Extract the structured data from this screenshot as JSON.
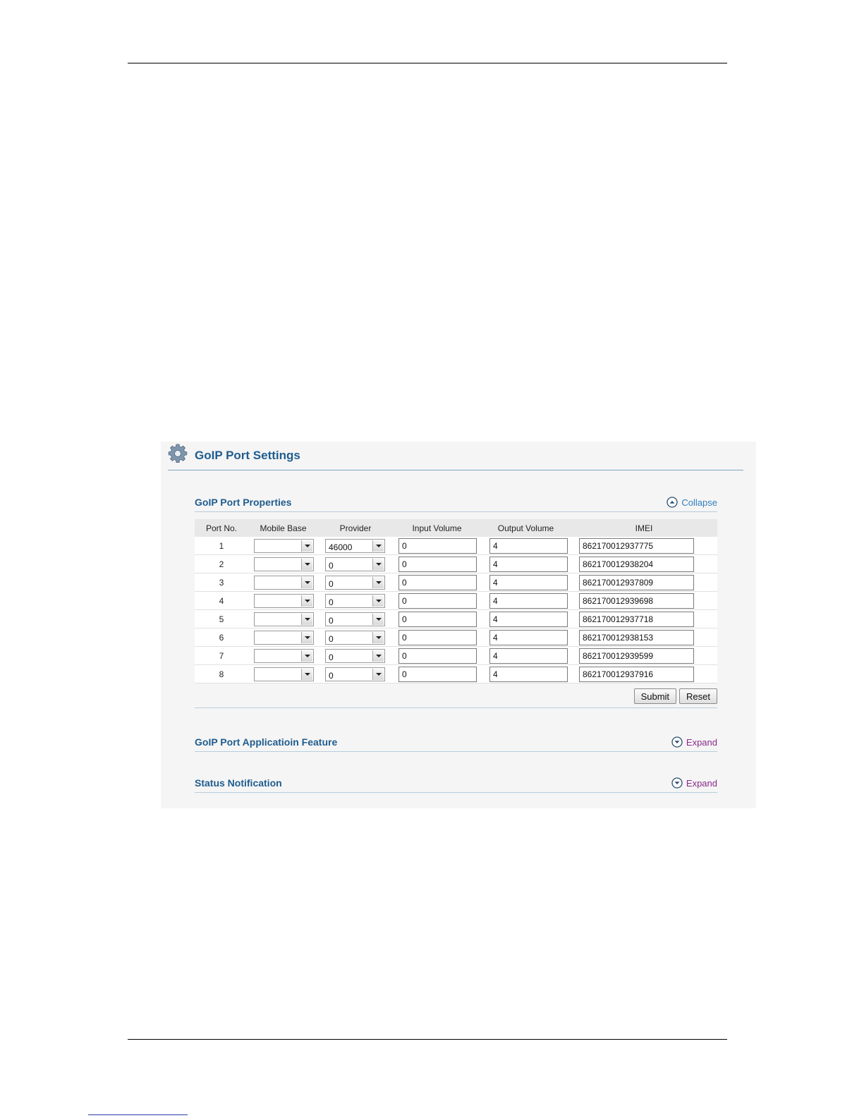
{
  "page": {
    "title": "GoIP Port Settings",
    "accent_color": "#1f5c8e"
  },
  "properties": {
    "title": "GoIP Port Properties",
    "toggle_label": "Collapse",
    "columns": [
      "Port No.",
      "Mobile Base",
      "Provider",
      "Input Volume",
      "Output Volume",
      "IMEI"
    ],
    "rows": [
      {
        "port": "1",
        "mobile_base": "",
        "provider": "46000",
        "input_volume": "0",
        "output_volume": "4",
        "imei": "862170012937775"
      },
      {
        "port": "2",
        "mobile_base": "",
        "provider": "0",
        "input_volume": "0",
        "output_volume": "4",
        "imei": "862170012938204"
      },
      {
        "port": "3",
        "mobile_base": "",
        "provider": "0",
        "input_volume": "0",
        "output_volume": "4",
        "imei": "862170012937809"
      },
      {
        "port": "4",
        "mobile_base": "",
        "provider": "0",
        "input_volume": "0",
        "output_volume": "4",
        "imei": "862170012939698"
      },
      {
        "port": "5",
        "mobile_base": "",
        "provider": "0",
        "input_volume": "0",
        "output_volume": "4",
        "imei": "862170012937718"
      },
      {
        "port": "6",
        "mobile_base": "",
        "provider": "0",
        "input_volume": "0",
        "output_volume": "4",
        "imei": "862170012938153"
      },
      {
        "port": "7",
        "mobile_base": "",
        "provider": "0",
        "input_volume": "0",
        "output_volume": "4",
        "imei": "862170012939599"
      },
      {
        "port": "8",
        "mobile_base": "",
        "provider": "0",
        "input_volume": "0",
        "output_volume": "4",
        "imei": "862170012937916"
      }
    ],
    "submit_label": "Submit",
    "reset_label": "Reset"
  },
  "application_feature": {
    "title": "GoIP Port Applicatioin Feature",
    "toggle_label": "Expand"
  },
  "status_notification": {
    "title": "Status Notification",
    "toggle_label": "Expand"
  },
  "icons": {
    "header": "gear-icon",
    "collapse": "chevron-up-circle-icon",
    "expand": "chevron-down-circle-icon"
  }
}
